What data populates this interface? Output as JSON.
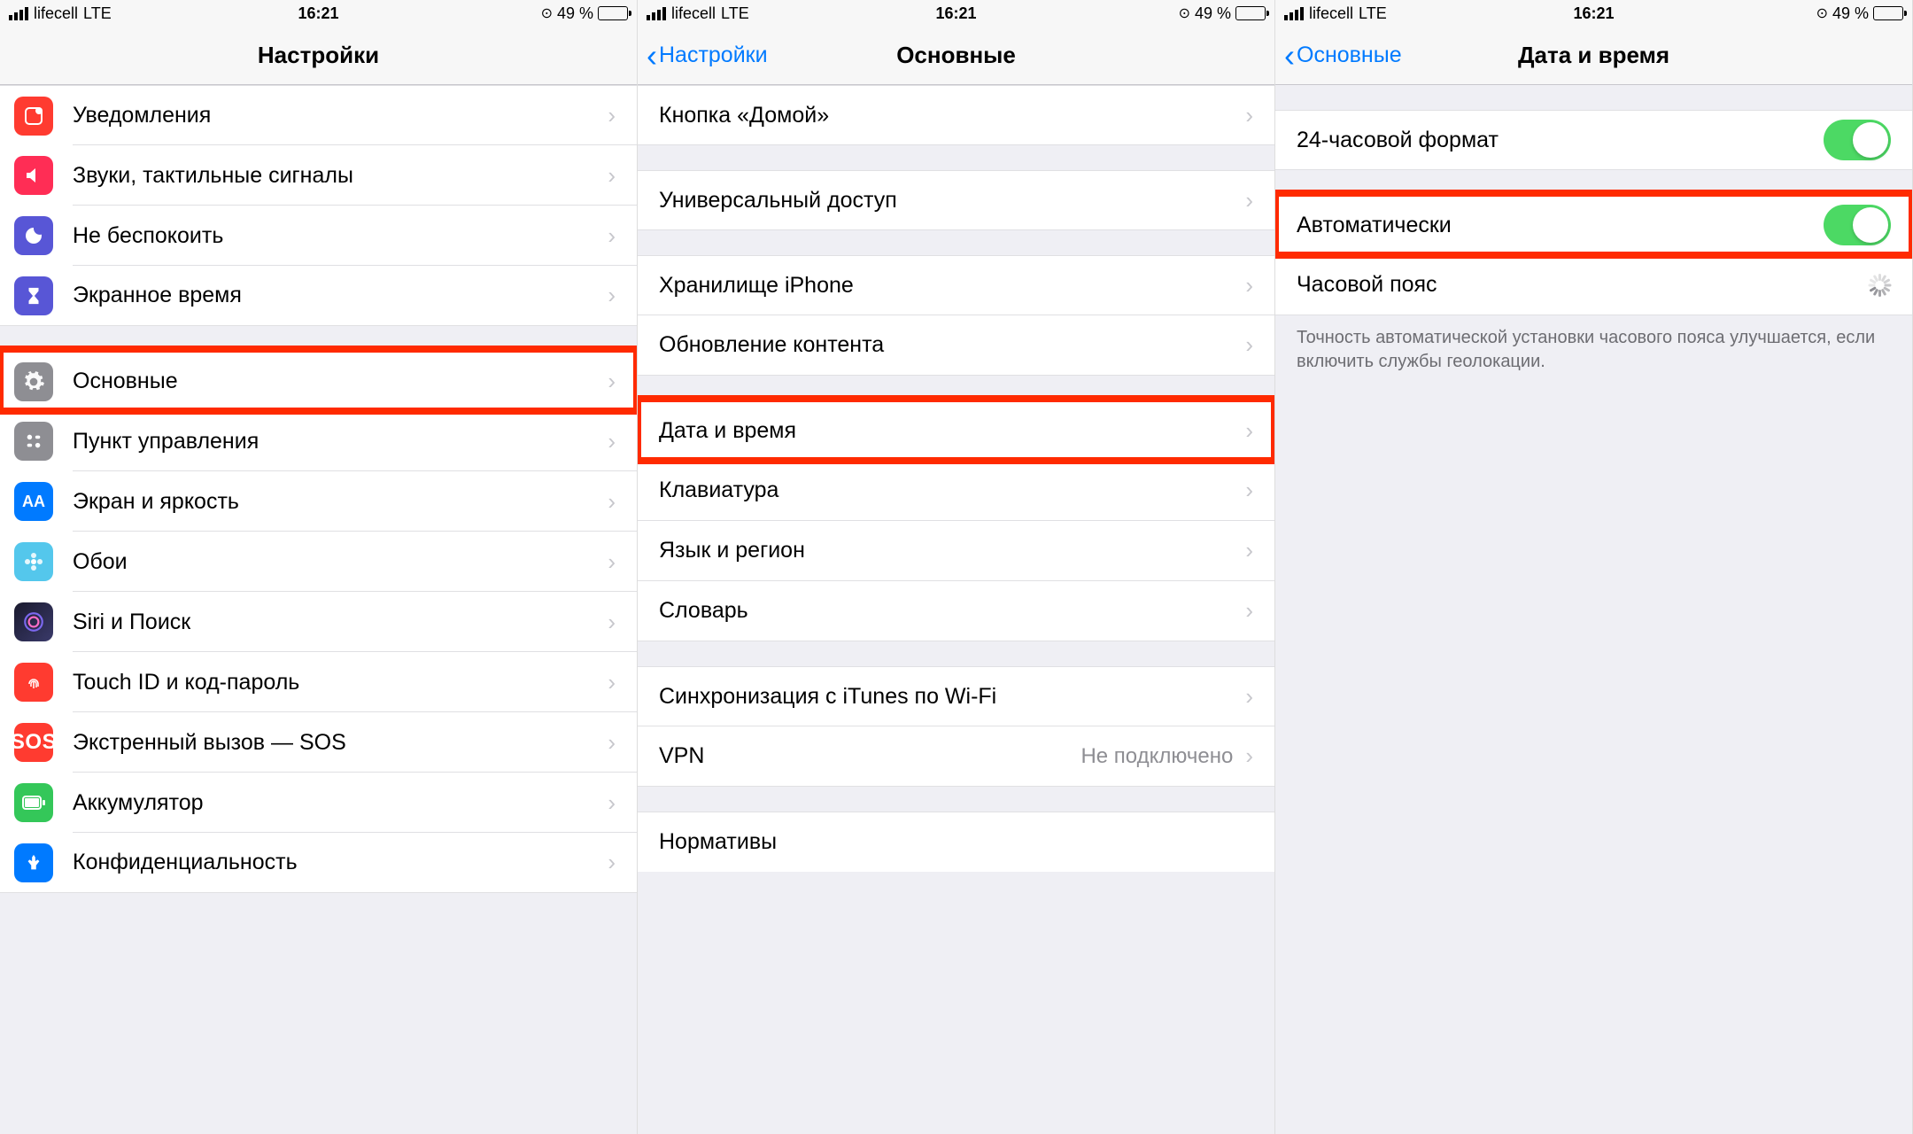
{
  "status": {
    "carrier": "lifecell",
    "network": "LTE",
    "time": "16:21",
    "battery_pct": "49 %"
  },
  "screen1": {
    "title": "Настройки",
    "items": {
      "notifications": "Уведомления",
      "sounds": "Звуки, тактильные сигналы",
      "dnd": "Не беспокоить",
      "screentime": "Экранное время",
      "general": "Основные",
      "control": "Пункт управления",
      "display": "Экран и яркость",
      "wallpaper": "Обои",
      "siri": "Siri и Поиск",
      "touchid": "Touch ID и код-пароль",
      "sos": "Экстренный вызов — SOS",
      "sos_icon": "SOS",
      "battery": "Аккумулятор",
      "privacy": "Конфиденциальность"
    }
  },
  "screen2": {
    "back": "Настройки",
    "title": "Основные",
    "items": {
      "home": "Кнопка «Домой»",
      "accessibility": "Универсальный доступ",
      "storage": "Хранилище iPhone",
      "refresh": "Обновление контента",
      "datetime": "Дата и время",
      "keyboard": "Клавиатура",
      "language": "Язык и регион",
      "dictionary": "Словарь",
      "itunes": "Синхронизация с iTunes по Wi-Fi",
      "vpn": "VPN",
      "vpn_value": "Не подключено",
      "regulatory": "Нормативы"
    }
  },
  "screen3": {
    "back": "Основные",
    "title": "Дата и время",
    "items": {
      "h24": "24-часовой формат",
      "auto": "Автоматически",
      "timezone": "Часовой пояс"
    },
    "footer": "Точность автоматической установки часового пояса улучшается, если включить службы геолокации."
  }
}
